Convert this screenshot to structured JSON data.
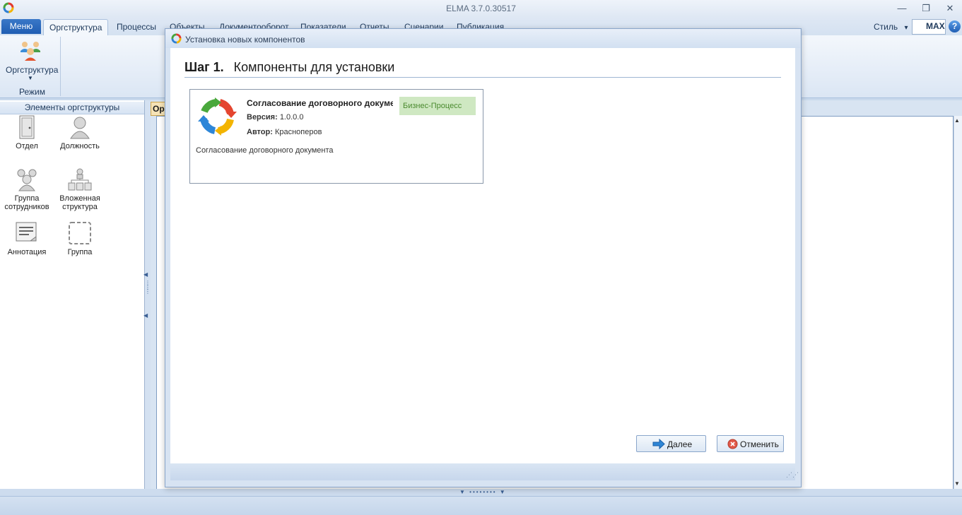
{
  "window": {
    "title": "ELMA 3.7.0.30517",
    "minimize_glyph": "—",
    "restore_glyph": "❐",
    "close_glyph": "✕"
  },
  "ribbon": {
    "menu_label": "Меню",
    "tabs": [
      "Оргструктура",
      "Процессы",
      "Объекты",
      "Документооборот",
      "Показатели",
      "Отчеты",
      "Сценарии",
      "Публикация"
    ],
    "style_label": "Стиль",
    "style_arrow": "▾",
    "max_label": "MAX",
    "help_glyph": "?",
    "group_button_label": "Оргструктура",
    "group_button_arrow": "▼",
    "group_label": "Режим"
  },
  "left_panel": {
    "header": "Элементы оргструктуры",
    "tools": [
      {
        "label": "Отдел"
      },
      {
        "label": "Должность"
      },
      {
        "label": "Группа сотрудников"
      },
      {
        "label": "Вложенная структура"
      },
      {
        "label": "Аннотация"
      },
      {
        "label": "Группа"
      }
    ]
  },
  "main": {
    "doc_tab_label": "Ор"
  },
  "dialog": {
    "title": "Установка новых компонентов",
    "step_number": "Шаг 1.",
    "step_title": "Компоненты для установки",
    "component": {
      "name": "Согласование договорного документа",
      "badge": "Бизнес-Процесс",
      "version_label": "Версия:",
      "version_value": "1.0.0.0",
      "author_label": "Автор:",
      "author_value": "Красноперов",
      "description": "Согласование договорного документа"
    },
    "next_label": "Далее",
    "cancel_label": "Отменить"
  },
  "icons": {
    "app_logo": "elma-logo-icon",
    "orgstruct": "people-group-icon",
    "department": "door-icon",
    "position": "person-icon",
    "employee_group": "people-icon",
    "nested_structure": "hierarchy-icon",
    "annotation": "note-icon",
    "group": "dashed-frame-icon",
    "component": "cycle-arrows-icon",
    "next": "arrow-right-icon",
    "cancel": "cancel-circle-icon"
  },
  "colors": {
    "accent": "#1f5db3",
    "badge_bg": "#cfe8c2",
    "badge_text": "#4a8a2e"
  }
}
